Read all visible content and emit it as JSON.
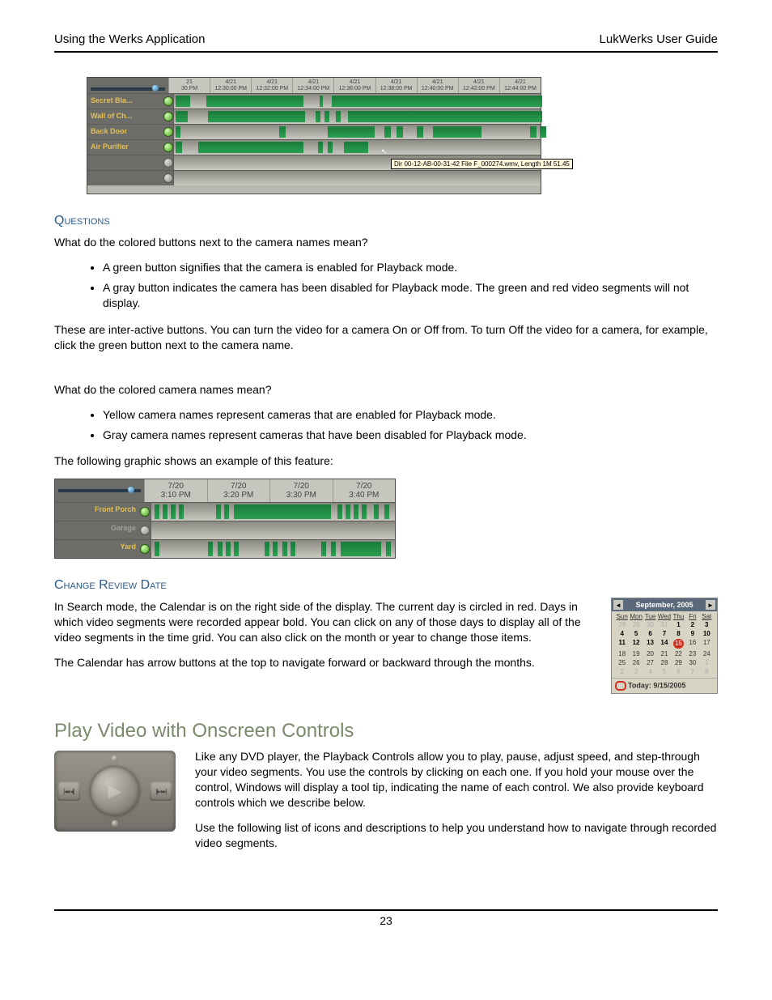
{
  "header": {
    "left": "Using the Werks Application",
    "right": "LukWerks User Guide"
  },
  "timeline1": {
    "ticks": [
      {
        "d": "21",
        "t": "30 PM"
      },
      {
        "d": "4/21",
        "t": "12:30:00 PM"
      },
      {
        "d": "4/21",
        "t": "12:32:00 PM"
      },
      {
        "d": "4/21",
        "t": "12:34:00 PM"
      },
      {
        "d": "4/21",
        "t": "12:36:00 PM"
      },
      {
        "d": "4/21",
        "t": "12:38:00 PM"
      },
      {
        "d": "4/21",
        "t": "12:40:00 PM"
      },
      {
        "d": "4/21",
        "t": "12:42:00 PM"
      },
      {
        "d": "4/21",
        "t": "12:44:00 PM"
      }
    ],
    "rows": [
      {
        "name": "Secret Bla...",
        "enabled": true
      },
      {
        "name": "Wall of Ch...",
        "enabled": true
      },
      {
        "name": "Back Door",
        "enabled": true
      },
      {
        "name": "Air Purifier",
        "enabled": true
      },
      {
        "name": "",
        "enabled": false
      },
      {
        "name": "",
        "enabled": false
      }
    ],
    "tooltip": "Dir 00-12-AB-00-31-42 File F_000274.wmv, Length 1M 51.45"
  },
  "sections": {
    "questions_title": "Questions",
    "q1": "What do the colored buttons next to the camera names mean?",
    "q1_b1": "A green button signifies that the camera is enabled for Playback mode.",
    "q1_b2": "A gray button indicates the camera has been disabled for Playback mode.  The green and red video segments  will not display.",
    "q1_after": "These are inter-active buttons.  You can turn the video for a camera On or Off from.  To turn Off the video for a camera, for example, click the green button next to the camera name.",
    "q2": "What do the colored camera names mean?",
    "q2_b1": "Yellow camera names represent cameras that are enabled for Playback mode.",
    "q2_b2": "Gray camera names represent cameras that have been disabled for Playback mode.",
    "q2_after": "The following graphic shows an example of this feature:",
    "change_title": "Change Review Date",
    "change_p1": "In Search mode, the Calendar is on the right side of the display.  The current day is circled in red. Days in which video segments were recorded appear bold. You can click on any of those days to display all of the video segments in the time grid.  You can also click on the month or year to change those items.",
    "change_p2": "The Calendar has arrow buttons at the top to navigate forward or backward through the months.",
    "play_title": "Play Video with Onscreen Controls",
    "play_p1": "Like any DVD player, the Playback Controls allow you to play, pause, adjust speed, and step-through your video segments. You use the controls by clicking on each one. If you hold your mouse over the control, Windows will display a tool tip, indicating the name of each control. We also provide keyboard controls which we describe below.",
    "play_p2": "Use the following list of icons and descriptions to help you understand how to navigate through recorded video segments."
  },
  "timeline2": {
    "ticks": [
      {
        "d": "7/20",
        "t": "3:10 PM"
      },
      {
        "d": "7/20",
        "t": "3:20 PM"
      },
      {
        "d": "7/20",
        "t": "3:30 PM"
      },
      {
        "d": "7/20",
        "t": "3:40 PM"
      }
    ],
    "rows": [
      {
        "name": "Front Porch",
        "enabled": true
      },
      {
        "name": "Garage",
        "enabled": false
      },
      {
        "name": "Yard",
        "enabled": true
      }
    ]
  },
  "calendar": {
    "title": "September, 2005",
    "dow": [
      "Sun",
      "Mon",
      "Tue",
      "Wed",
      "Thu",
      "Fri",
      "Sat"
    ],
    "cells": [
      {
        "n": "28",
        "dim": true
      },
      {
        "n": "29",
        "dim": true
      },
      {
        "n": "30",
        "dim": true
      },
      {
        "n": "31",
        "dim": true
      },
      {
        "n": "1",
        "bold": true
      },
      {
        "n": "2",
        "bold": true
      },
      {
        "n": "3",
        "bold": true
      },
      {
        "n": "4",
        "bold": true
      },
      {
        "n": "5",
        "bold": true
      },
      {
        "n": "6",
        "bold": true
      },
      {
        "n": "7",
        "bold": true
      },
      {
        "n": "8",
        "bold": true
      },
      {
        "n": "9",
        "bold": true
      },
      {
        "n": "10",
        "bold": true
      },
      {
        "n": "11",
        "bold": true
      },
      {
        "n": "12",
        "bold": true
      },
      {
        "n": "13",
        "bold": true
      },
      {
        "n": "14",
        "bold": true
      },
      {
        "n": "15",
        "today": true
      },
      {
        "n": "16"
      },
      {
        "n": "17"
      },
      {
        "n": "18"
      },
      {
        "n": "19"
      },
      {
        "n": "20"
      },
      {
        "n": "21"
      },
      {
        "n": "22"
      },
      {
        "n": "23"
      },
      {
        "n": "24"
      },
      {
        "n": "25"
      },
      {
        "n": "26"
      },
      {
        "n": "27"
      },
      {
        "n": "28"
      },
      {
        "n": "29"
      },
      {
        "n": "30"
      },
      {
        "n": "1",
        "dim": true
      },
      {
        "n": "2",
        "dim": true
      },
      {
        "n": "3",
        "dim": true
      },
      {
        "n": "4",
        "dim": true
      },
      {
        "n": "5",
        "dim": true
      },
      {
        "n": "6",
        "dim": true
      },
      {
        "n": "7",
        "dim": true
      },
      {
        "n": "8",
        "dim": true
      }
    ],
    "today_label": "Today: 9/15/2005"
  },
  "dial": {
    "left": "|◂◂ ◂||",
    "right": "||▸ ▸▸|",
    "top": "◂||▸"
  },
  "page_number": "23"
}
